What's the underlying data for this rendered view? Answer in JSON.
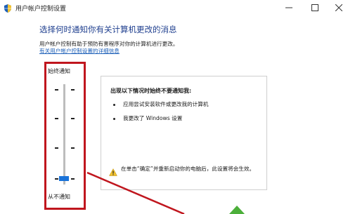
{
  "window": {
    "title": "用户帐户控制设置",
    "icon": "uac-shield-icon",
    "controls": [
      "minimize",
      "maximize",
      "close"
    ]
  },
  "main": {
    "heading": "选择何时通知你有关计算机更改的消息",
    "description": "用户帐户控制有助于预防有害程序对你的计算机进行更改。",
    "link": "有关用户帐户控制设置的详细信息"
  },
  "slider": {
    "top_label": "始终通知",
    "bottom_label": "从不通知",
    "level": 0,
    "levels": 4
  },
  "info": {
    "title": "出现以下情况时始终不要通知我:",
    "items": [
      "应用尝试安装软件或更改我的计算机",
      "我更改了 Windows 设置"
    ],
    "warning": "在单击“确定”并重新启动你的电脑后，此设置将会生效。"
  },
  "colors": {
    "heading": "#1f3f8f",
    "link": "#1c5fb8",
    "annotation": "#c0161e",
    "thumb": "#1a73d9"
  }
}
